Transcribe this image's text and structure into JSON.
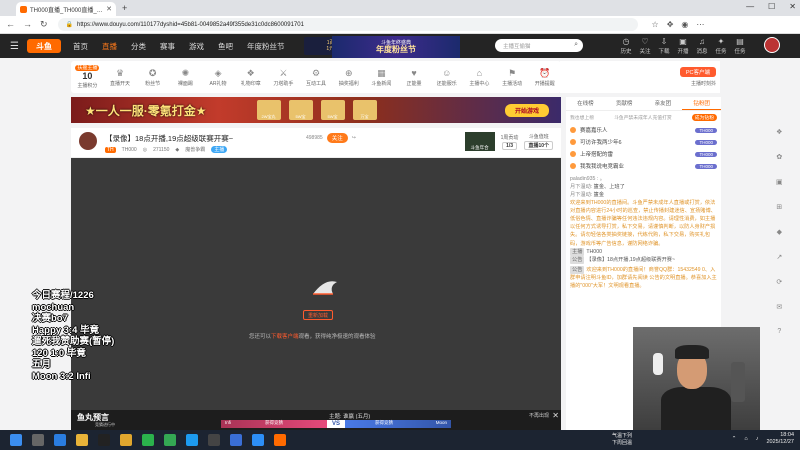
{
  "browser": {
    "tab_title": "TH000直播_TH000直播_TH000视...",
    "url": "https://www.douyu.com/110177dyshid=45b81-0049852a49f355de31c0dc8600091701"
  },
  "site": {
    "logo": "斗鱼",
    "nav": [
      "首页",
      "直播",
      "分类",
      "赛事",
      "游戏",
      "鱼吧",
      "年度粉丝节"
    ],
    "promo_line1": "1百1桂套装",
    "promo_line2": "1元0的55秒",
    "festival": "年度粉丝节",
    "festival_sub": "斗鱼年终盛典",
    "search_placeholder": "主播互偷猫",
    "header_icons": [
      "历史",
      "关注",
      "下载",
      "开播",
      "消息",
      "任务",
      "任务"
    ],
    "brand_color": "#ff6a00"
  },
  "room_toolbar": {
    "level_badge": "扶摇主播",
    "level_num": "10",
    "level_label": "主播积分",
    "items": [
      "直播开天",
      "粉丝节",
      "裸面踢",
      "AR礼物",
      "礼物印章",
      "刀塔助手",
      "互动工具",
      "抽奖福利",
      "斗鱼新闻",
      "正能量",
      "还能服乐",
      "主播中心",
      "主播活动",
      "开播提醒",
      "贵族VIP"
    ],
    "pc_button": "PC客户端",
    "pc_sub": "主播时刻抖"
  },
  "ad": {
    "title": "★一人一服·零氪打金★",
    "cta": "开始游戏",
    "boxes": [
      "2W宝丸",
      "5W宝",
      "5W宝",
      "万宝"
    ]
  },
  "room": {
    "title": "【录像】18点开播,19点超级联赛开赛~",
    "hot": "498985",
    "follow": "关注",
    "streamer_tag": "TH",
    "streamer": "TH000",
    "viewers": "271150",
    "category": "魔兽争霸",
    "category_badge": "主播",
    "thumb_label": "斗鱼年合",
    "rank_label": "1周贡动",
    "rank_value": "1/3",
    "fans_label": "斗鱼值班",
    "fans_value": "直播10个"
  },
  "player": {
    "retry": "重新加载",
    "hint_prefix": "您还可以",
    "hint_link": "下载客户端",
    "hint_suffix": "观看，获得纯净极速的观看体验"
  },
  "bottom_bar": {
    "brand": "鱼丸预言",
    "brand_sub": "竞猜进行中",
    "topic": "主题: 谁赢 (五月)",
    "left_name": "Infi",
    "left_label": "获得竞猜",
    "right_label": "获得竞猜",
    "right_name": "Moon",
    "vs": "VS",
    "noshow": "不再出现"
  },
  "right_panel": {
    "tabs": [
      "在线榜",
      "贡献榜",
      "亲友团",
      "钻粉团"
    ],
    "rank_header": "我也想上榜",
    "rank_note": "斗鱼严禁未成年人充值打赏",
    "rank_badge": "成为钻粉",
    "rank_rows": [
      {
        "name": "赛嘉嘉乐人",
        "badge": "TH000"
      },
      {
        "name": "可访许我两少年6",
        "badge": "TH000"
      },
      {
        "name": "上帝搭配的雷",
        "badge": "TH000"
      },
      {
        "name": "我我我说电竞霸业",
        "badge": "TH000"
      }
    ],
    "chat_user": "paladin935 : 。",
    "chat1_user": "月下温动:",
    "chat1_text": "簠金、上班了",
    "chat2_user": "月下温动:",
    "chat2_text": "簠金",
    "sys_msg": "欢迎来到TH000的直播间。斗鱼严禁未成年人直播或打赏，依法对直播内容进行24小时的巡查，禁止传播封建迷信、宣扬赌博、低俗色情、直播诈骗等任何违法违规内容。请理性消费，如主播以任何方式诱导打赏，私下交易，请谨慎判断，以防人身财产损失。请勿轻信各类抽奖链接，代练代购，私下交易，购买礼包码，游戏币等广告信息，谨防网络诈骗。",
    "host_tag": "主播",
    "host_name": "TH000",
    "room_tag": "公告",
    "room_title": "【录像】18点开播,19点超级联赛开赛~",
    "announce_tag": "公告",
    "announce": "欢迎来到TH000的直播间！商誉QQ群：15432549 0、入群申请注明斗鱼ID，加群请先阅读 公告的文明直播。恭喜加入主播的\"000\"大军！文明观看直播。"
  },
  "overlay": {
    "lines": [
      "今日赛程/1226",
      "mochuan",
      "决赛bo7",
      "Happy  3:4 毕竟",
      "遛死我赞助赛(暂停)",
      "120     1:0 毕竟",
      "五月",
      "Moon  3:2 Infi"
    ]
  },
  "taskbar": {
    "weather_line1": "气温下列",
    "weather_line2": "下周回温",
    "time": "18:04",
    "date": "2025/12/27"
  }
}
